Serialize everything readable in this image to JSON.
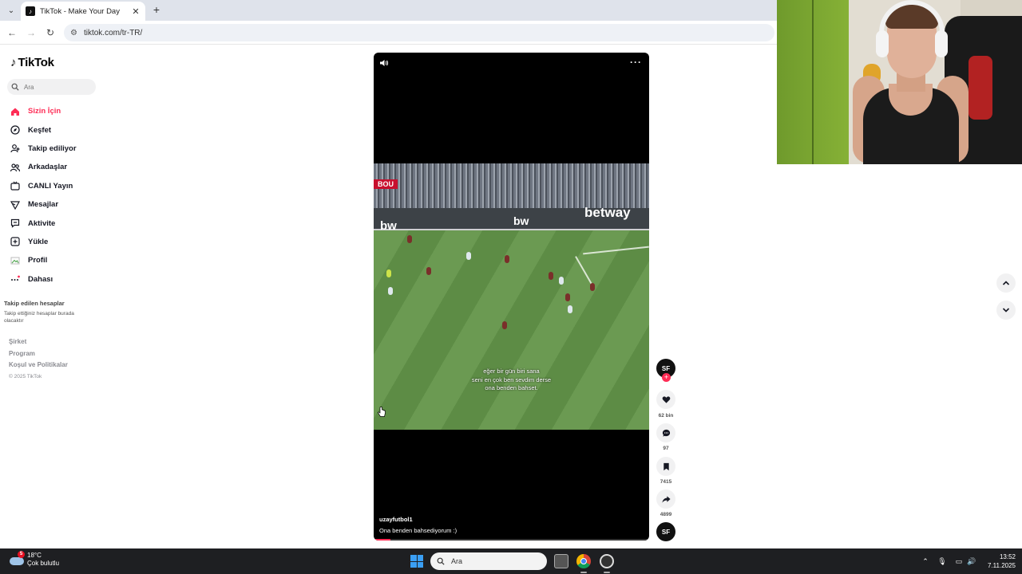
{
  "browser": {
    "tab_title": "TikTok - Make Your Day",
    "url": "tiktok.com/tr-TR/"
  },
  "sidebar": {
    "logo": "TikTok",
    "search_placeholder": "Ara",
    "nav": [
      {
        "label": "Sizin İçin",
        "icon": "home-icon",
        "active": true
      },
      {
        "label": "Keşfet",
        "icon": "compass-icon"
      },
      {
        "label": "Takip ediliyor",
        "icon": "follow-user-icon"
      },
      {
        "label": "Arkadaşlar",
        "icon": "friends-icon"
      },
      {
        "label": "CANLI Yayın",
        "icon": "live-icon"
      },
      {
        "label": "Mesajlar",
        "icon": "send-icon"
      },
      {
        "label": "Aktivite",
        "icon": "activity-icon"
      },
      {
        "label": "Yükle",
        "icon": "upload-icon"
      },
      {
        "label": "Profil",
        "icon": "profile-icon"
      },
      {
        "label": "Dahası",
        "icon": "more-dots-icon"
      }
    ],
    "followed_title": "Takip edilen hesaplar",
    "followed_desc": "Takip ettiğiniz hesaplar burada olacaktır",
    "footer": [
      "Şirket",
      "Program",
      "Koşul ve Politikalar"
    ],
    "copyright": "© 2025 TikTok"
  },
  "video": {
    "team_badge": "BOU",
    "hoarding_1": "bw",
    "hoarding_2": "bw",
    "hoarding_3": "betway",
    "subtitle_lines": [
      "eğer bir gün biri sana",
      "seni en çok ben sevdim derse",
      "ona benden bahset."
    ],
    "username": "uzayfutbol1",
    "caption": "Ona benden bahsediyorum :)",
    "progress": 0.06
  },
  "actions": {
    "avatar_initials": "SF",
    "likes": "62 bin",
    "comments": "97",
    "saves": "7415",
    "shares": "4899"
  },
  "taskbar": {
    "temperature": "18°C",
    "weather": "Çok bulutlu",
    "weather_badge": "5",
    "search_label": "Ara",
    "time": "13:52",
    "date": "7.11.2025"
  },
  "colors": {
    "accent": "#fe2c55",
    "text": "#161823",
    "taskbar": "#1e1f22"
  }
}
